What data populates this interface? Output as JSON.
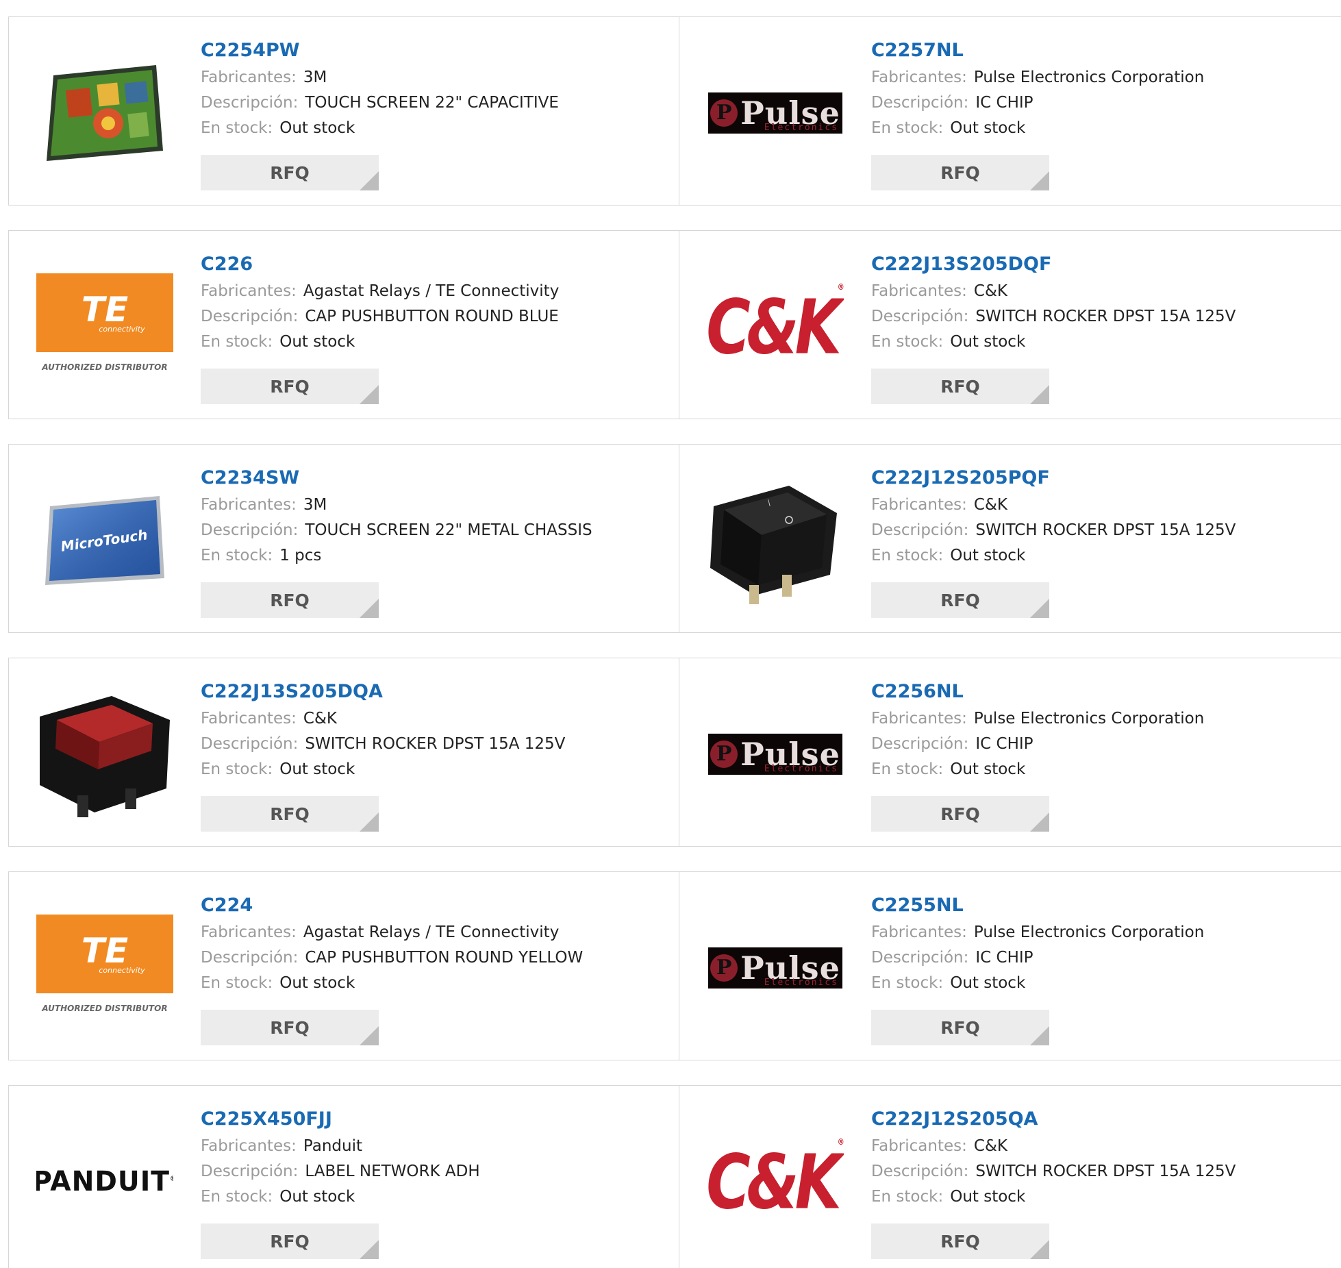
{
  "labels": {
    "manufacturer": "Fabricantes:",
    "description": "Descripción:",
    "stock": "En stock:",
    "rfq": "RFQ"
  },
  "logos": {
    "pulse": {
      "word": "Pulse",
      "sub": "Electronics"
    },
    "te": {
      "mark": "TE",
      "sub": "connectivity",
      "authorized": "AUTHORIZED DISTRIBUTOR"
    },
    "ck": {
      "mark": "C&K"
    },
    "panduit": {
      "mark": "PANDUIT"
    },
    "microtouch": {
      "mark": "MicroTouch"
    }
  },
  "products": [
    {
      "pn": "C2254PW",
      "manufacturer": "3M",
      "description": "TOUCH SCREEN 22\" CAPACITIVE",
      "stock": "Out stock",
      "image": "touchscreen-colorful"
    },
    {
      "pn": "C2257NL",
      "manufacturer": "Pulse Electronics Corporation",
      "description": "IC CHIP",
      "stock": "Out stock",
      "image": "pulse-logo"
    },
    {
      "pn": "C226",
      "manufacturer": "Agastat Relays / TE Connectivity",
      "description": "CAP PUSHBUTTON ROUND BLUE",
      "stock": "Out stock",
      "image": "te-logo"
    },
    {
      "pn": "C222J13S205DQF",
      "manufacturer": "C&K",
      "description": "SWITCH ROCKER DPST 15A 125V",
      "stock": "Out stock",
      "image": "ck-logo"
    },
    {
      "pn": "C2234SW",
      "manufacturer": "3M",
      "description": "TOUCH SCREEN 22\" METAL CHASSIS",
      "stock": "1 pcs",
      "image": "touchscreen-microtouch"
    },
    {
      "pn": "C222J12S205PQF",
      "manufacturer": "C&K",
      "description": "SWITCH ROCKER DPST 15A 125V",
      "stock": "Out stock",
      "image": "rocker-black"
    },
    {
      "pn": "C222J13S205DQA",
      "manufacturer": "C&K",
      "description": "SWITCH ROCKER DPST 15A 125V",
      "stock": "Out stock",
      "image": "rocker-red"
    },
    {
      "pn": "C2256NL",
      "manufacturer": "Pulse Electronics Corporation",
      "description": "IC CHIP",
      "stock": "Out stock",
      "image": "pulse-logo"
    },
    {
      "pn": "C224",
      "manufacturer": "Agastat Relays / TE Connectivity",
      "description": "CAP PUSHBUTTON ROUND YELLOW",
      "stock": "Out stock",
      "image": "te-logo"
    },
    {
      "pn": "C2255NL",
      "manufacturer": "Pulse Electronics Corporation",
      "description": "IC CHIP",
      "stock": "Out stock",
      "image": "pulse-logo"
    },
    {
      "pn": "C225X450FJJ",
      "manufacturer": "Panduit",
      "description": "LABEL NETWORK ADH",
      "stock": "Out stock",
      "image": "panduit-logo"
    },
    {
      "pn": "C222J12S205QA",
      "manufacturer": "C&K",
      "description": "SWITCH ROCKER DPST 15A 125V",
      "stock": "Out stock",
      "image": "ck-logo"
    }
  ]
}
